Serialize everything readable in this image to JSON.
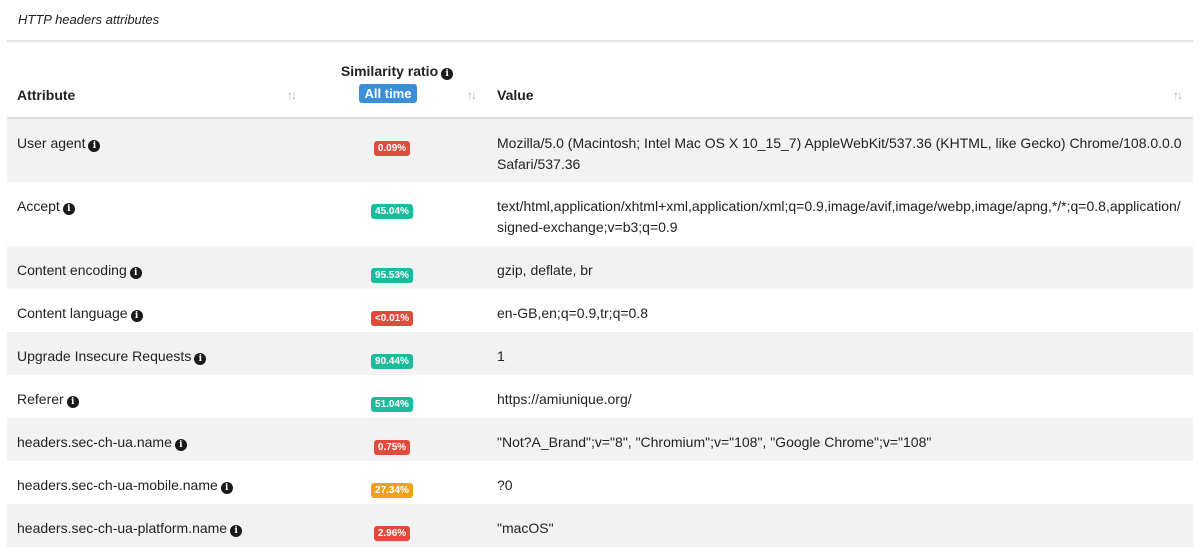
{
  "caption": "HTTP headers attributes",
  "header": {
    "attribute": "Attribute",
    "similarity": "Similarity ratio",
    "all_time": "All time",
    "value": "Value",
    "sort_glyph": "↑↓"
  },
  "rows": [
    {
      "attribute": "User agent",
      "ratio": "0.09%",
      "color": "red",
      "value": "Mozilla/5.0 (Macintosh; Intel Mac OS X 10_15_7) AppleWebKit/537.36 (KHTML, like Gecko) Chrome/108.0.0.0 Safari/537.36"
    },
    {
      "attribute": "Accept",
      "ratio": "45.04%",
      "color": "green",
      "value": "text/html,application/xhtml+xml,application/xml;q=0.9,image/avif,image/webp,image/apng,*/*;q=0.8,application/signed-exchange;v=b3;q=0.9"
    },
    {
      "attribute": "Content encoding",
      "ratio": "95.53%",
      "color": "green",
      "value": "gzip, deflate, br"
    },
    {
      "attribute": "Content language",
      "ratio": "<0.01%",
      "color": "red",
      "value": "en-GB,en;q=0.9,tr;q=0.8"
    },
    {
      "attribute": "Upgrade Insecure Requests",
      "ratio": "90.44%",
      "color": "green",
      "value": "1"
    },
    {
      "attribute": "Referer",
      "ratio": "51.04%",
      "color": "green",
      "value": "https://amiunique.org/"
    },
    {
      "attribute": "headers.sec-ch-ua.name",
      "ratio": "0.75%",
      "color": "red",
      "value": "\"Not?A_Brand\";v=\"8\", \"Chromium\";v=\"108\", \"Google Chrome\";v=\"108\""
    },
    {
      "attribute": "headers.sec-ch-ua-mobile.name",
      "ratio": "27.34%",
      "color": "orange",
      "value": "?0"
    },
    {
      "attribute": "headers.sec-ch-ua-platform.name",
      "ratio": "2.96%",
      "color": "red",
      "value": "\"macOS\""
    }
  ],
  "colors": {
    "red": "#e04b3c",
    "green": "#1abc9c",
    "orange": "#f0a01c",
    "accent": "#3a8fd8"
  },
  "icons": {
    "info": "info-circle-icon",
    "sort": "sort-arrows-icon"
  }
}
